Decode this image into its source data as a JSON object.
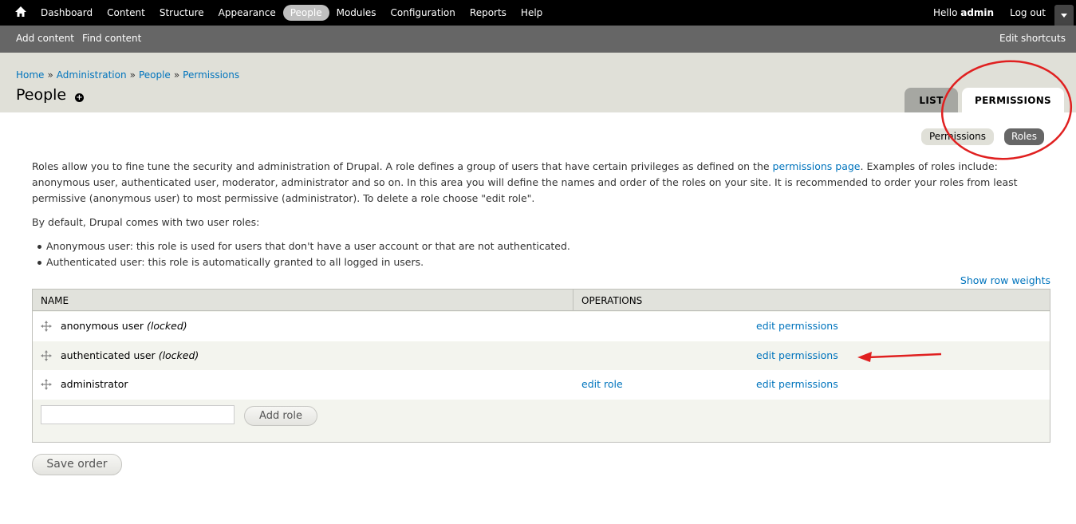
{
  "toolbar": {
    "menu": [
      "Dashboard",
      "Content",
      "Structure",
      "Appearance",
      "People",
      "Modules",
      "Configuration",
      "Reports",
      "Help"
    ],
    "active_menu": "People",
    "hello_prefix": "Hello ",
    "user_name": "admin",
    "logout": "Log out"
  },
  "shortcuts": {
    "items": [
      "Add content",
      "Find content"
    ],
    "edit": "Edit shortcuts"
  },
  "breadcrumb": {
    "items": [
      "Home",
      "Administration",
      "People",
      "Permissions"
    ],
    "separator": "»"
  },
  "page": {
    "title": "People",
    "add_shortcut_symbol": "+"
  },
  "tabs": {
    "primary": [
      "LIST",
      "PERMISSIONS"
    ],
    "active_primary": "PERMISSIONS",
    "secondary": [
      "Permissions",
      "Roles"
    ],
    "active_secondary": "Roles"
  },
  "content": {
    "intro_before_link": "Roles allow you to fine tune the security and administration of Drupal. A role defines a group of users that have certain privileges as defined on the ",
    "intro_link": "permissions page",
    "intro_after_link": ". Examples of roles include: anonymous user, authenticated user, moderator, administrator and so on. In this area you will define the names and order of the roles on your site. It is recommended to order your roles from least permissive (anonymous user) to most permissive (administrator). To delete a role choose \"edit role\".",
    "default_roles_heading": "By default, Drupal comes with two user roles:",
    "default_roles": [
      "Anonymous user: this role is used for users that don't have a user account or that are not authenticated.",
      "Authenticated user: this role is automatically granted to all logged in users."
    ],
    "show_row_weights": "Show row weights"
  },
  "table": {
    "headers": [
      "NAME",
      "OPERATIONS"
    ],
    "rows": [
      {
        "name": "anonymous user",
        "note": "(locked)",
        "edit_role": "",
        "edit_permissions": "edit permissions"
      },
      {
        "name": "authenticated user",
        "note": "(locked)",
        "edit_role": "",
        "edit_permissions": "edit permissions"
      },
      {
        "name": "administrator",
        "note": "",
        "edit_role": "edit role",
        "edit_permissions": "edit permissions"
      }
    ],
    "new_role_placeholder": "",
    "add_role_button": "Add role"
  },
  "actions": {
    "save_order": "Save order"
  },
  "colors": {
    "link": "#0074bd",
    "toolbar_bg": "#000000",
    "shortcuts_bg": "#666666",
    "header_bg": "#e0e0d8",
    "annotation": "#e02020"
  }
}
